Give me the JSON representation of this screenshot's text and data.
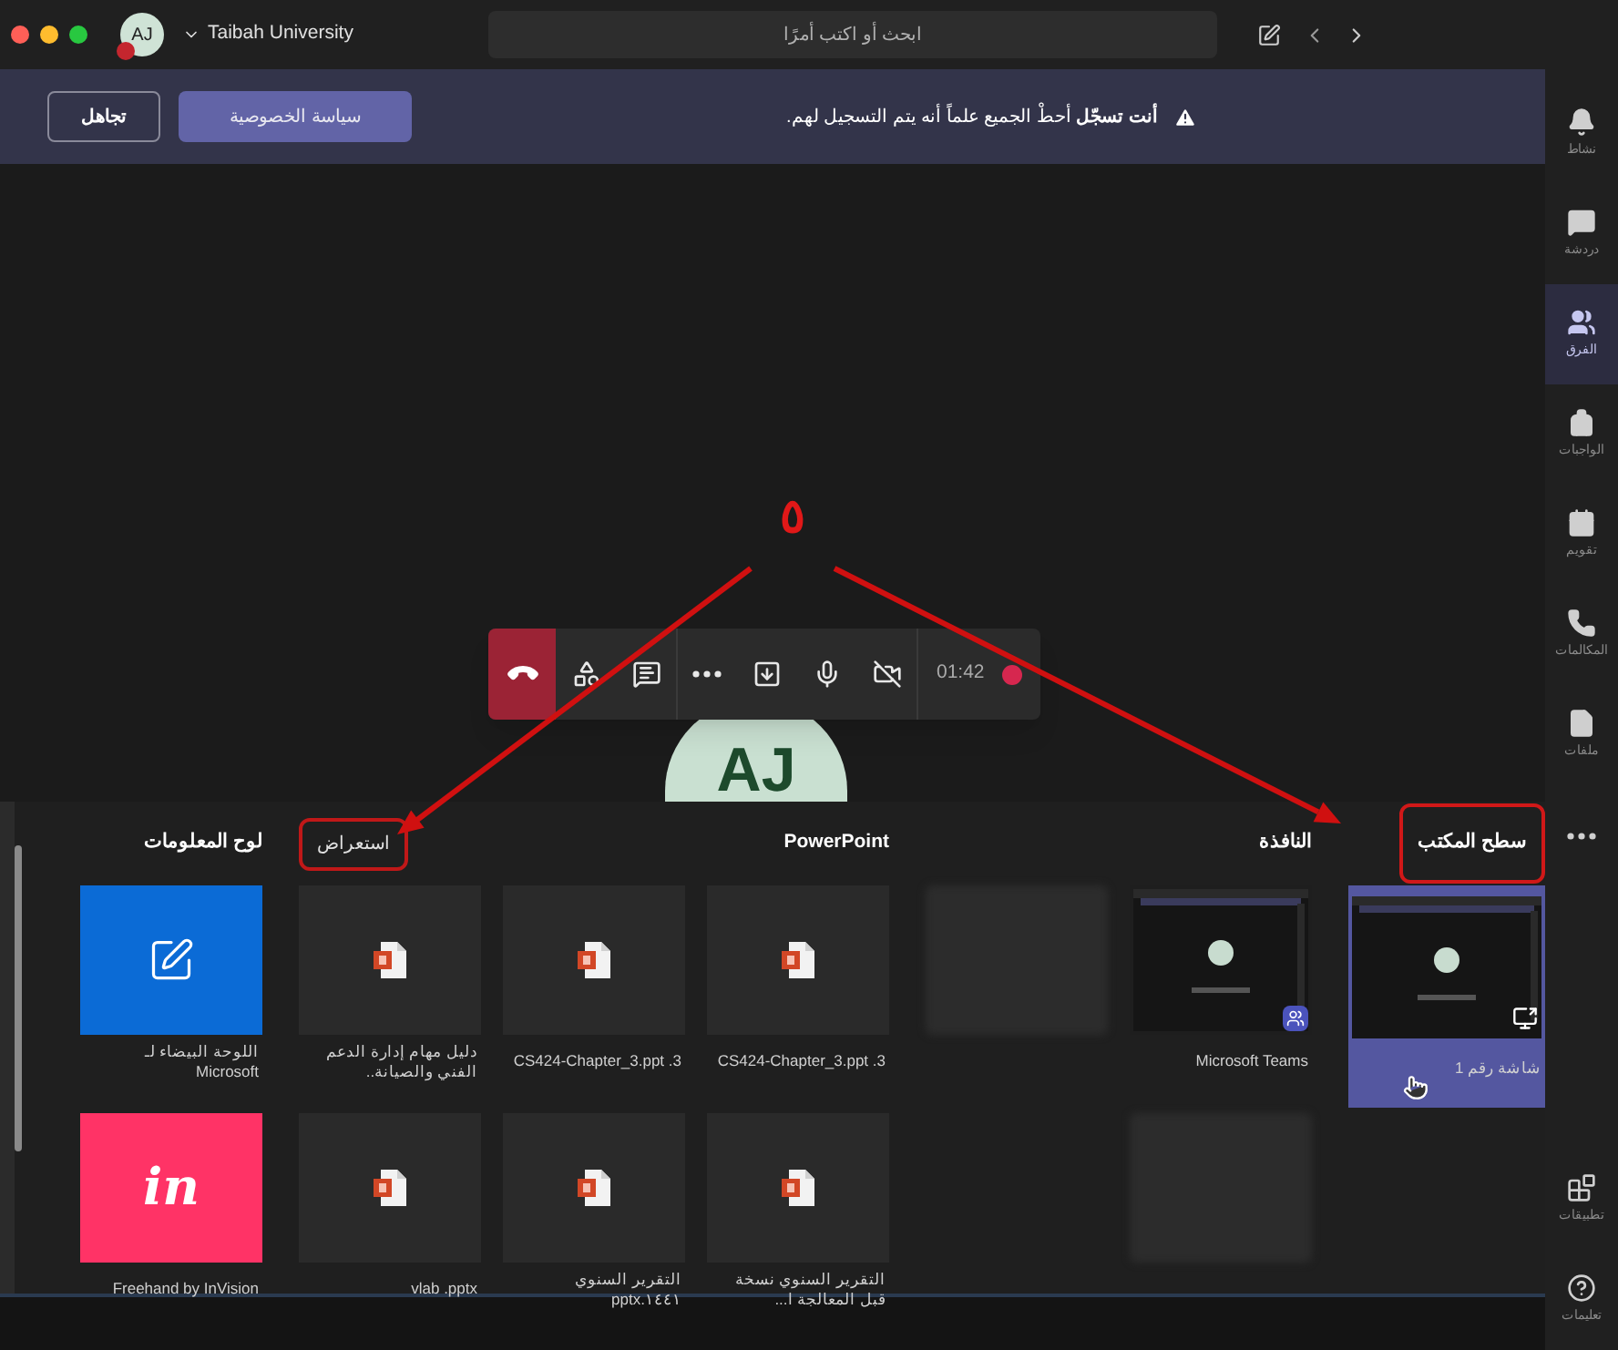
{
  "title_bar": {
    "avatar": "AJ",
    "org": "Taibah University",
    "search": {
      "placeholder": "ابحث أو اكتب أمرًا"
    }
  },
  "banner": {
    "message": "**أنت تسجّل** أحطْ الجميع علماً أنه يتم التسجيل لهم.",
    "buttons": [
      {
        "label": "سياسة الخصوصية",
        "kind": "primary"
      },
      {
        "label": "تجاهل",
        "kind": "outline"
      }
    ]
  },
  "stage": {
    "avatar": "AJ"
  },
  "call_controls": {
    "items": [
      {
        "kind": "hangup"
      },
      {
        "kind": "apps"
      },
      {
        "kind": "chat"
      },
      {
        "kind": "more"
      },
      {
        "kind": "share"
      },
      {
        "kind": "mic"
      },
      {
        "kind": "camera_off"
      }
    ],
    "timer": "01:42",
    "recording": true
  },
  "share_tray": {
    "sections": [
      {
        "kind": "desktop",
        "title": "سطح المكتب",
        "highlighted": true,
        "items": [
          {
            "kind": "screen",
            "caption": "شاشة رقم 1",
            "selected": true
          }
        ]
      },
      {
        "kind": "window",
        "title": "النافذة",
        "highlighted": false,
        "items": [
          {
            "kind": "app",
            "caption": "Microsoft Teams",
            "selected": false
          },
          {
            "kind": "blurred",
            "selected": false
          },
          {
            "kind": "blurred",
            "selected": false
          }
        ]
      },
      {
        "kind": "powerpoint",
        "title": "PowerPoint",
        "highlighted": false,
        "browse": {
          "label": "استعراض",
          "highlighted": true
        },
        "items": [
          {
            "kind": "ppt",
            "caption": "CS424-Chapter_3.ppt .3",
            "selected": false
          },
          {
            "kind": "ppt",
            "caption": "CS424-Chapter_3.ppt .3",
            "selected": false
          },
          {
            "kind": "ppt",
            "caption": "دليل مهام إدارة الدعم الفني والصيانة..",
            "selected": false
          },
          {
            "kind": "ppt",
            "caption": "التقرير السنوي نسخة قبل المعالجة ا...",
            "selected": false
          },
          {
            "kind": "ppt",
            "caption": "التقرير السنوي ١٤٤١.pptx",
            "selected": false
          },
          {
            "kind": "ppt",
            "caption": "vlab .pptx",
            "selected": false
          }
        ]
      },
      {
        "kind": "whiteboard",
        "title": "لوح المعلومات",
        "highlighted": false,
        "items": [
          {
            "kind": "whiteboard",
            "caption": "اللوحة البيضاء لـ Microsoft",
            "selected": false
          },
          {
            "kind": "invision",
            "logo": "in",
            "caption": "Freehand by InVision",
            "selected": false
          }
        ]
      }
    ]
  },
  "app_rail": [
    {
      "label": "نشاط",
      "selected": false
    },
    {
      "label": "دردشة",
      "selected": false
    },
    {
      "label": "الفرق",
      "selected": true
    },
    {
      "label": "الواجبات",
      "selected": false
    },
    {
      "label": "تقويم",
      "selected": false
    },
    {
      "label": "المكالمات",
      "selected": false
    },
    {
      "label": "ملفات",
      "selected": false
    },
    {
      "selected": false
    },
    {
      "label": "تطبيقات",
      "selected": false
    },
    {
      "label": "تعليمات",
      "selected": false
    }
  ],
  "annotation": {
    "mark": "٥"
  }
}
